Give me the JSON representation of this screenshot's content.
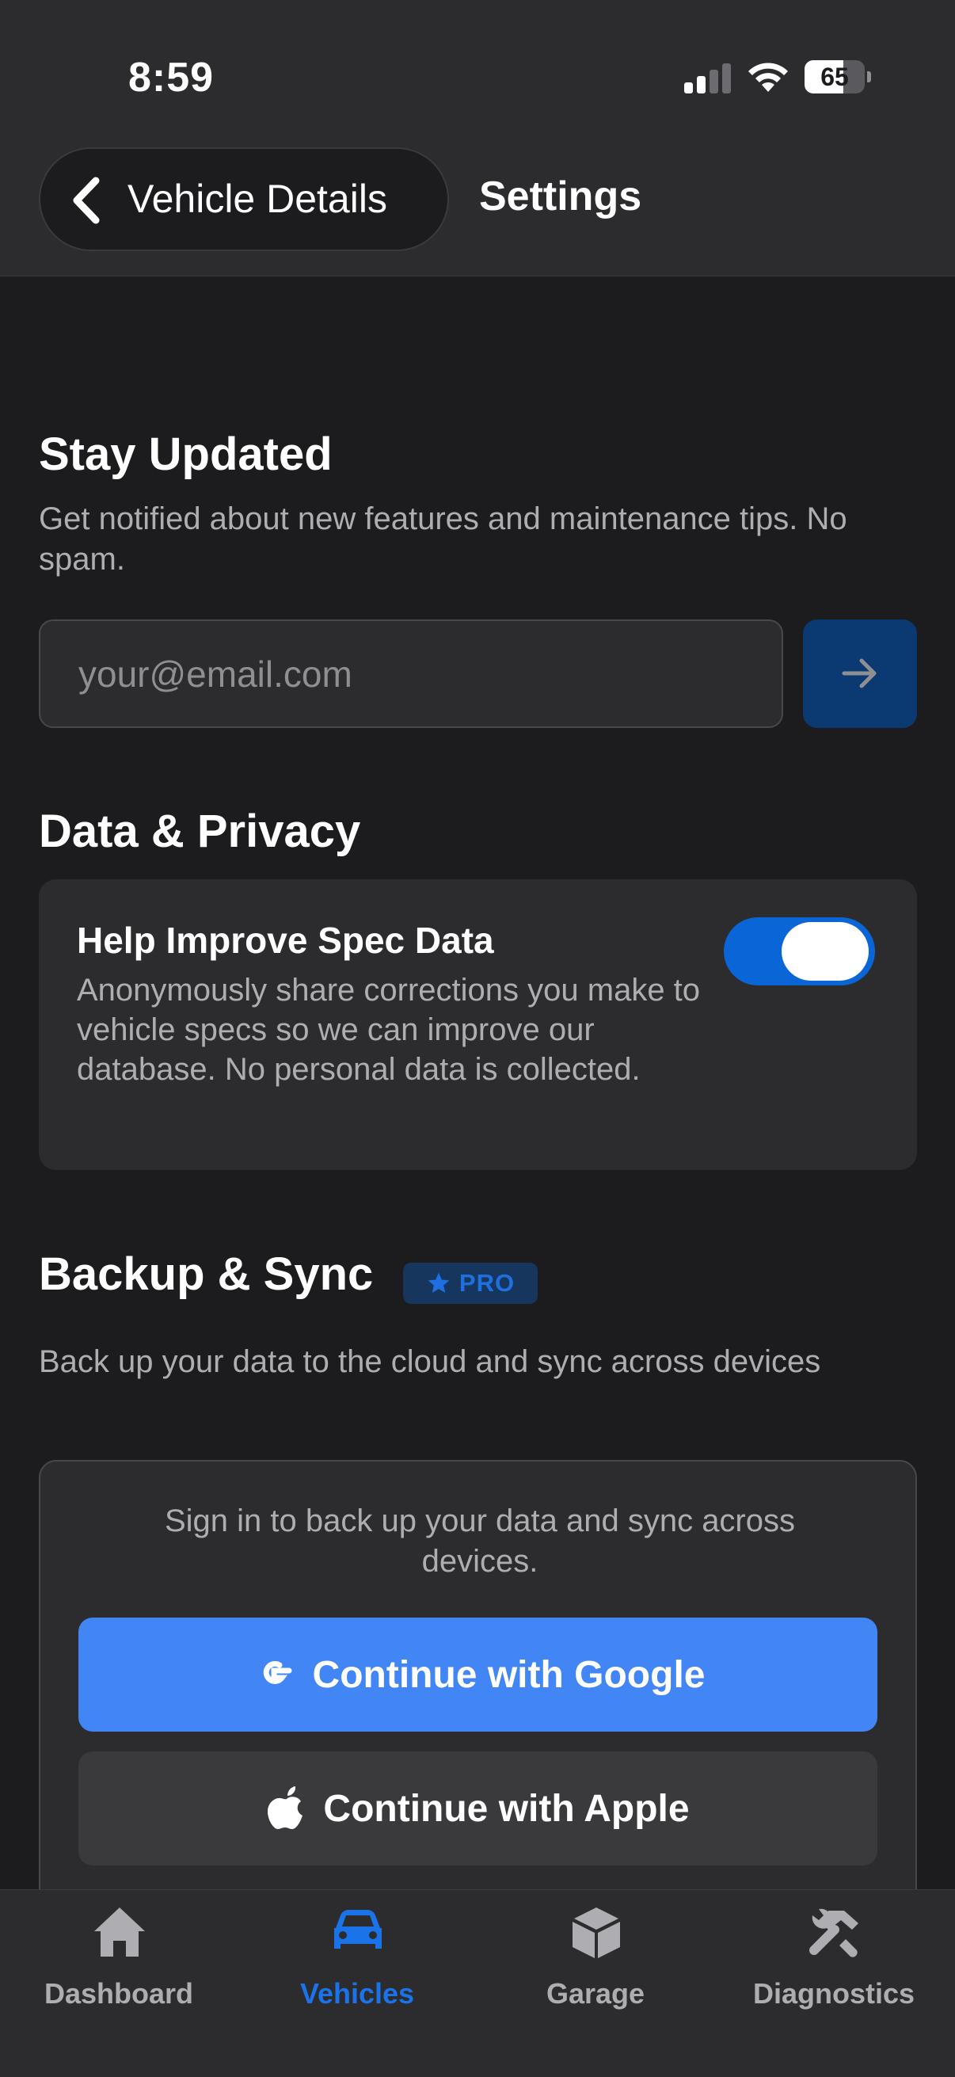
{
  "status_bar": {
    "time": "8:59",
    "battery_percent": "65",
    "battery_level": 0.65,
    "signal_bars_active": 2
  },
  "header": {
    "back_label": "Vehicle Details",
    "title": "Settings"
  },
  "stay_updated": {
    "heading": "Stay Updated",
    "description": "Get notified about new features and maintenance tips. No spam.",
    "email_value": "",
    "email_placeholder": "your@email.com"
  },
  "privacy": {
    "heading": "Data & Privacy",
    "card_title": "Help Improve Spec Data",
    "card_description": "Anonymously share corrections you make to vehicle specs so we can improve our database. No personal data is collected.",
    "toggle_on": true
  },
  "backup": {
    "heading": "Backup & Sync",
    "badge": "PRO",
    "description": "Back up your data to the cloud and sync across devices",
    "sign_in_text": "Sign in to back up your data and sync across devices.",
    "google_label": "Continue with Google",
    "apple_label": "Continue with Apple"
  },
  "tabs": [
    {
      "label": "Dashboard",
      "icon": "house-icon",
      "active": false
    },
    {
      "label": "Vehicles",
      "icon": "car-icon",
      "active": true
    },
    {
      "label": "Garage",
      "icon": "cube-icon",
      "active": false
    },
    {
      "label": "Diagnostics",
      "icon": "wrench-hammer-icon",
      "active": false
    }
  ],
  "colors": {
    "accent": "#1a73e8",
    "toggle": "#0a66d6",
    "google_button": "#4285f4",
    "background": "#1c1c1e",
    "surface": "#2c2c2e"
  }
}
